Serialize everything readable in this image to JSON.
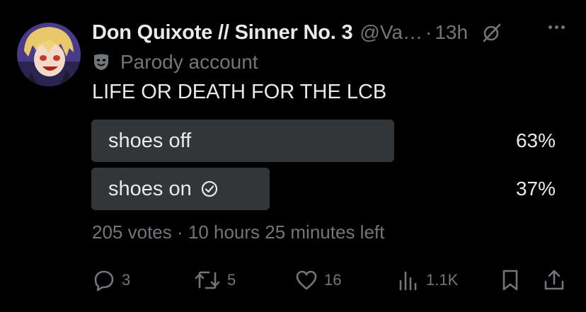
{
  "tweet": {
    "display_name": "Don Quixote // Sinner No. 3",
    "handle": "@Va…",
    "separator": "·",
    "time": "13h",
    "label": "Parody account",
    "text": "LIFE OR DEATH FOR THE LCB"
  },
  "poll": {
    "options": [
      {
        "label": "shoes off",
        "percent_text": "63%",
        "percent": 63,
        "voted": false
      },
      {
        "label": "shoes on",
        "percent_text": "37%",
        "percent": 37,
        "voted": true
      }
    ],
    "meta": "205 votes · 10 hours 25 minutes left"
  },
  "actions": {
    "replies": "3",
    "reposts": "5",
    "likes": "16",
    "views": "1.1K"
  },
  "colors": {
    "background": "#000000",
    "text": "#e7e9ea",
    "muted": "#71767b",
    "poll_bar": "#333639"
  }
}
